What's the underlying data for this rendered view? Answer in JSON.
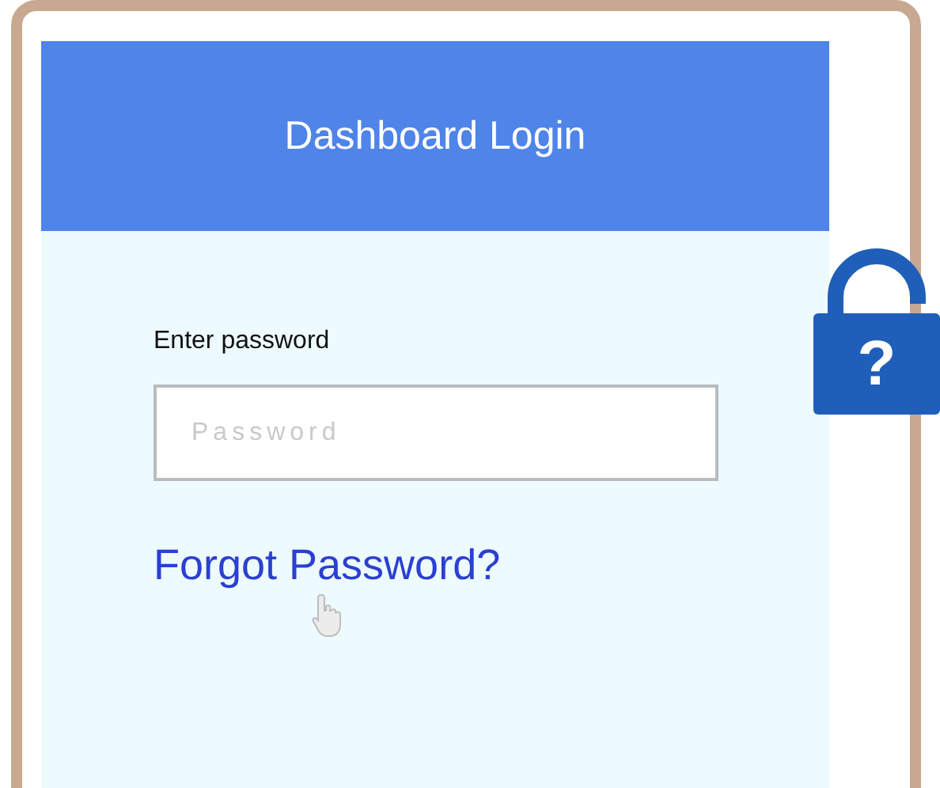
{
  "header": {
    "title": "Dashboard Login"
  },
  "form": {
    "label": "Enter password",
    "placeholder": "Password",
    "link": "Forgot Password?"
  },
  "lock_badge": {
    "symbol": "?"
  }
}
